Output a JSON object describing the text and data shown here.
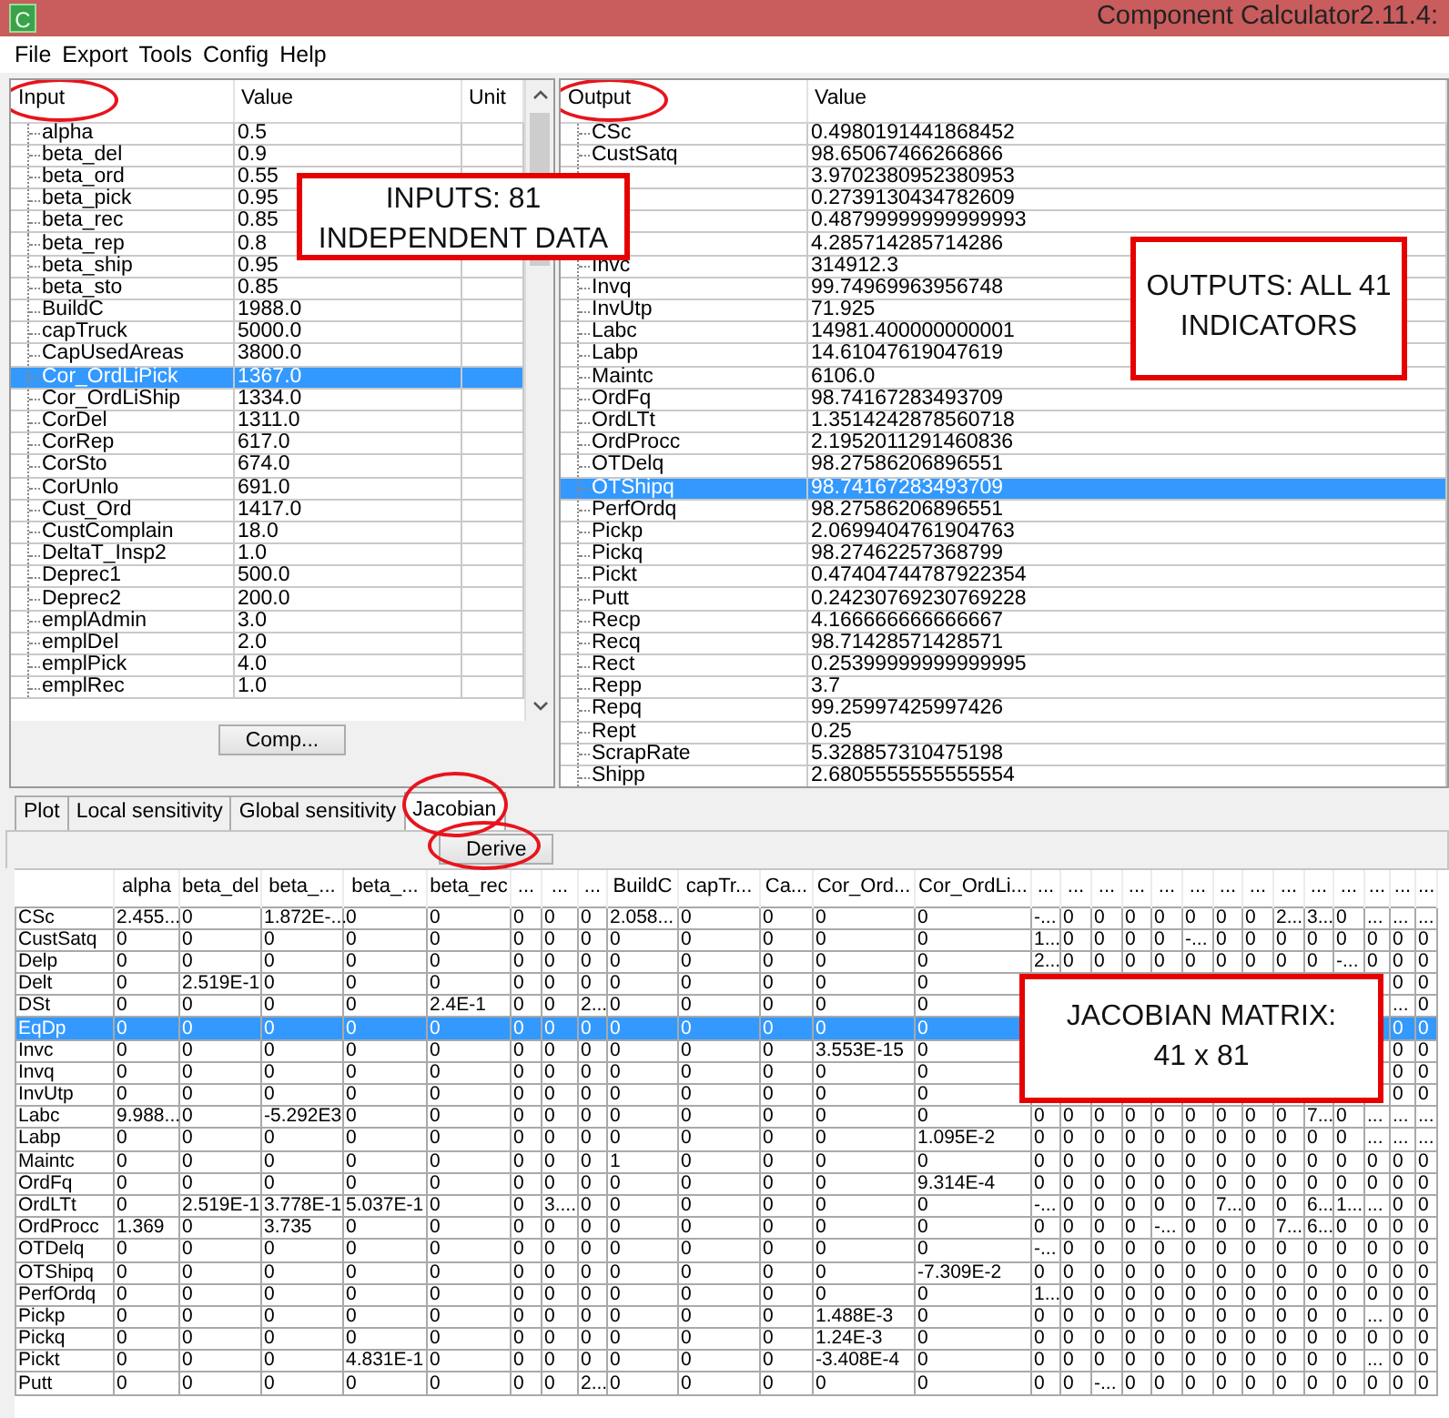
{
  "window": {
    "icon_letter": "C",
    "title": "Component Calculator2.11.4:"
  },
  "menu": [
    "File",
    "Export",
    "Tools",
    "Config",
    "Help"
  ],
  "inputs_table": {
    "columns": [
      {
        "label": "Input",
        "circled": true
      },
      {
        "label": "Value",
        "circled": false
      },
      {
        "label": "Unit",
        "circled": false
      }
    ],
    "rows": [
      {
        "name": "alpha",
        "value": "0.5",
        "selected": false
      },
      {
        "name": "beta_del",
        "value": "0.9",
        "selected": false
      },
      {
        "name": "beta_ord",
        "value": "0.55",
        "selected": false
      },
      {
        "name": "beta_pick",
        "value": "0.95",
        "selected": false
      },
      {
        "name": "beta_rec",
        "value": "0.85",
        "selected": false
      },
      {
        "name": "beta_rep",
        "value": "0.8",
        "selected": false
      },
      {
        "name": "beta_ship",
        "value": "0.95",
        "selected": false
      },
      {
        "name": "beta_sto",
        "value": "0.85",
        "selected": false
      },
      {
        "name": "BuildC",
        "value": "1988.0",
        "selected": false
      },
      {
        "name": "capTruck",
        "value": "5000.0",
        "selected": false
      },
      {
        "name": "CapUsedAreas",
        "value": "3800.0",
        "selected": false
      },
      {
        "name": "Cor_OrdLiPick",
        "value": "1367.0",
        "selected": true
      },
      {
        "name": "Cor_OrdLiShip",
        "value": "1334.0",
        "selected": false
      },
      {
        "name": "CorDel",
        "value": "1311.0",
        "selected": false
      },
      {
        "name": "CorRep",
        "value": "617.0",
        "selected": false
      },
      {
        "name": "CorSto",
        "value": "674.0",
        "selected": false
      },
      {
        "name": "CorUnlo",
        "value": "691.0",
        "selected": false
      },
      {
        "name": "Cust_Ord",
        "value": "1417.0",
        "selected": false
      },
      {
        "name": "CustComplain",
        "value": "18.0",
        "selected": false
      },
      {
        "name": "DeltaT_Insp2",
        "value": "1.0",
        "selected": false
      },
      {
        "name": "Deprec1",
        "value": "500.0",
        "selected": false
      },
      {
        "name": "Deprec2",
        "value": "200.0",
        "selected": false
      },
      {
        "name": "emplAdmin",
        "value": "3.0",
        "selected": false
      },
      {
        "name": "emplDel",
        "value": "2.0",
        "selected": false
      },
      {
        "name": "emplPick",
        "value": "4.0",
        "selected": false
      },
      {
        "name": "emplRec",
        "value": "1.0",
        "selected": false
      }
    ]
  },
  "comp_button": "Comp...",
  "outputs_table": {
    "columns": [
      {
        "label": "Output",
        "circled": true
      },
      {
        "label": "Value",
        "circled": false
      }
    ],
    "rows": [
      {
        "name": "CSc",
        "value": "0.4980191441868452",
        "selected": false
      },
      {
        "name": "CustSatq",
        "value": "98.65067466266866",
        "selected": false
      },
      {
        "name": null,
        "value": "3.9702380952380953",
        "selected": false
      },
      {
        "name": null,
        "value": "0.2739130434782609",
        "selected": false
      },
      {
        "name": null,
        "value": "0.48799999999999993",
        "selected": false
      },
      {
        "name": null,
        "value": "4.285714285714286",
        "selected": false
      },
      {
        "name": "Invc",
        "value": "314912.3",
        "selected": false
      },
      {
        "name": "Invq",
        "value": "99.74969963956748",
        "selected": false
      },
      {
        "name": "InvUtp",
        "value": "71.925",
        "selected": false
      },
      {
        "name": "Labc",
        "value": "14981.400000000001",
        "selected": false
      },
      {
        "name": "Labp",
        "value": "14.61047619047619",
        "selected": false
      },
      {
        "name": "Maintc",
        "value": "6106.0",
        "selected": false
      },
      {
        "name": "OrdFq",
        "value": "98.74167283493709",
        "selected": false
      },
      {
        "name": "OrdLTt",
        "value": "1.3514242878560718",
        "selected": false
      },
      {
        "name": "OrdProcc",
        "value": "2.1952011291460836",
        "selected": false
      },
      {
        "name": "OTDelq",
        "value": "98.27586206896551",
        "selected": false
      },
      {
        "name": "OTShipq",
        "value": "98.74167283493709",
        "selected": true
      },
      {
        "name": "PerfOrdq",
        "value": "98.27586206896551",
        "selected": false
      },
      {
        "name": "Pickp",
        "value": "2.0699404761904763",
        "selected": false
      },
      {
        "name": "Pickq",
        "value": "98.27462257368799",
        "selected": false
      },
      {
        "name": "Pickt",
        "value": "0.47404744787922354",
        "selected": false
      },
      {
        "name": "Putt",
        "value": "0.24230769230769228",
        "selected": false
      },
      {
        "name": "Recp",
        "value": "4.166666666666667",
        "selected": false
      },
      {
        "name": "Recq",
        "value": "98.71428571428571",
        "selected": false
      },
      {
        "name": "Rect",
        "value": "0.25399999999999995",
        "selected": false
      },
      {
        "name": "Repp",
        "value": "3.7",
        "selected": false
      },
      {
        "name": "Repq",
        "value": "99.25997425997426",
        "selected": false
      },
      {
        "name": "Rept",
        "value": "0.25",
        "selected": false
      },
      {
        "name": "ScrapRate",
        "value": "5.328857310475198",
        "selected": false
      },
      {
        "name": "Shipp",
        "value": "2.6805555555555554",
        "selected": false
      }
    ]
  },
  "tabs": [
    {
      "label": "Plot",
      "selected": false,
      "circled": false
    },
    {
      "label": "Local sensitivity",
      "selected": false,
      "circled": false
    },
    {
      "label": "Global sensitivity",
      "selected": false,
      "circled": false
    },
    {
      "label": "Jacobian",
      "selected": true,
      "circled": true
    }
  ],
  "derive_button": {
    "label": "Derive",
    "circled": true
  },
  "jacobian": {
    "columns": [
      "alpha",
      "beta_del",
      "beta_...",
      "beta_...",
      "beta_rec",
      "...",
      "...",
      "...",
      "BuildC",
      "capTr...",
      "Ca...",
      "Cor_Ord...",
      "Cor_OrdLi...",
      "...",
      "...",
      "...",
      "...",
      "...",
      "...",
      "...",
      "...",
      "...",
      "...",
      "...",
      "...",
      "...",
      "..."
    ],
    "rows": [
      {
        "name": "CSc",
        "selected": false,
        "cells": [
          "2.455...",
          "0",
          "1.872E-...",
          "0",
          "0",
          "0",
          "0",
          "0",
          "2.058...",
          "0",
          "0",
          "0",
          "0",
          "-...",
          "0",
          "0",
          "0",
          "0",
          "0",
          "0",
          "0",
          "2...",
          "3...",
          "0",
          "...",
          "...",
          "..."
        ]
      },
      {
        "name": "CustSatq",
        "selected": false,
        "cells": [
          "0",
          "0",
          "0",
          "0",
          "0",
          "0",
          "0",
          "0",
          "0",
          "0",
          "0",
          "0",
          "0",
          "1...",
          "0",
          "0",
          "0",
          "0",
          "-...",
          "0",
          "0",
          "0",
          "0",
          "0",
          "0",
          "0",
          "0"
        ]
      },
      {
        "name": "Delp",
        "selected": false,
        "cells": [
          "0",
          "0",
          "0",
          "0",
          "0",
          "0",
          "0",
          "0",
          "0",
          "0",
          "0",
          "0",
          "0",
          "2...",
          "0",
          "0",
          "0",
          "0",
          "0",
          "0",
          "0",
          "0",
          "0",
          "-...",
          "0",
          "0",
          "0"
        ]
      },
      {
        "name": "Delt",
        "selected": false,
        "cells": [
          "0",
          "2.519E-1",
          "0",
          "0",
          "0",
          "0",
          "0",
          "0",
          "0",
          "0",
          "0",
          "0",
          "0",
          null,
          null,
          null,
          null,
          null,
          null,
          null,
          null,
          null,
          null,
          null,
          null,
          "0",
          "0"
        ]
      },
      {
        "name": "DSt",
        "selected": false,
        "cells": [
          "0",
          "0",
          "0",
          "0",
          "2.4E-1",
          "0",
          "0",
          "2...",
          "0",
          "0",
          "0",
          "0",
          "0",
          null,
          null,
          null,
          null,
          null,
          null,
          null,
          null,
          null,
          null,
          null,
          null,
          "...",
          "0"
        ]
      },
      {
        "name": "EqDp",
        "selected": true,
        "cells": [
          "0",
          "0",
          "0",
          "0",
          "0",
          "0",
          "0",
          "0",
          "0",
          "0",
          "0",
          "0",
          "0",
          null,
          null,
          null,
          null,
          null,
          null,
          null,
          null,
          null,
          null,
          null,
          null,
          "0",
          "0"
        ]
      },
      {
        "name": "Invc",
        "selected": false,
        "cells": [
          "0",
          "0",
          "0",
          "0",
          "0",
          "0",
          "0",
          "0",
          "0",
          "0",
          "0",
          "3.553E-15",
          "0",
          null,
          null,
          null,
          null,
          null,
          null,
          null,
          null,
          null,
          null,
          null,
          null,
          "0",
          "0"
        ]
      },
      {
        "name": "Invq",
        "selected": false,
        "cells": [
          "0",
          "0",
          "0",
          "0",
          "0",
          "0",
          "0",
          "0",
          "0",
          "0",
          "0",
          "0",
          "0",
          null,
          null,
          null,
          null,
          null,
          null,
          null,
          null,
          null,
          null,
          null,
          null,
          "0",
          "0"
        ]
      },
      {
        "name": "InvUtp",
        "selected": false,
        "cells": [
          "0",
          "0",
          "0",
          "0",
          "0",
          "0",
          "0",
          "0",
          "0",
          "0",
          "0",
          "0",
          "0",
          null,
          null,
          null,
          null,
          null,
          null,
          null,
          null,
          null,
          null,
          null,
          null,
          "0",
          "0"
        ]
      },
      {
        "name": "Labc",
        "selected": false,
        "cells": [
          "9.988...",
          "0",
          "-5.292E3",
          "0",
          "0",
          "0",
          "0",
          "0",
          "0",
          "0",
          "0",
          "0",
          "0",
          "0",
          "0",
          "0",
          "0",
          "0",
          "0",
          "0",
          "0",
          "0",
          "7...",
          "0",
          "...",
          "...",
          "..."
        ]
      },
      {
        "name": "Labp",
        "selected": false,
        "cells": [
          "0",
          "0",
          "0",
          "0",
          "0",
          "0",
          "0",
          "0",
          "0",
          "0",
          "0",
          "0",
          "1.095E-2",
          "0",
          "0",
          "0",
          "0",
          "0",
          "0",
          "0",
          "0",
          "0",
          "0",
          "0",
          "...",
          "...",
          "..."
        ]
      },
      {
        "name": "Maintc",
        "selected": false,
        "cells": [
          "0",
          "0",
          "0",
          "0",
          "0",
          "0",
          "0",
          "0",
          "1",
          "0",
          "0",
          "0",
          "0",
          "0",
          "0",
          "0",
          "0",
          "0",
          "0",
          "0",
          "0",
          "0",
          "0",
          "0",
          "0",
          "0",
          "0"
        ]
      },
      {
        "name": "OrdFq",
        "selected": false,
        "cells": [
          "0",
          "0",
          "0",
          "0",
          "0",
          "0",
          "0",
          "0",
          "0",
          "0",
          "0",
          "0",
          "9.314E-4",
          "0",
          "0",
          "0",
          "0",
          "0",
          "0",
          "0",
          "0",
          "0",
          "0",
          "0",
          "0",
          "0",
          "0"
        ]
      },
      {
        "name": "OrdLTt",
        "selected": false,
        "cells": [
          "0",
          "2.519E-1",
          "3.778E-1",
          "5.037E-1",
          "0",
          "0",
          "3....",
          "0",
          "0",
          "0",
          "0",
          "0",
          "0",
          "-...",
          "0",
          "0",
          "0",
          "0",
          "0",
          "7...",
          "0",
          "0",
          "6...",
          "1...",
          "...",
          "0",
          "0"
        ]
      },
      {
        "name": "OrdProcc",
        "selected": false,
        "cells": [
          "1.369",
          "0",
          "3.735",
          "0",
          "0",
          "0",
          "0",
          "0",
          "0",
          "0",
          "0",
          "0",
          "0",
          "0",
          "0",
          "0",
          "0",
          "-...",
          "0",
          "0",
          "0",
          "7...",
          "6...",
          "0",
          "0",
          "0",
          "0"
        ]
      },
      {
        "name": "OTDelq",
        "selected": false,
        "cells": [
          "0",
          "0",
          "0",
          "0",
          "0",
          "0",
          "0",
          "0",
          "0",
          "0",
          "0",
          "0",
          "0",
          "-...",
          "0",
          "0",
          "0",
          "0",
          "0",
          "0",
          "0",
          "0",
          "0",
          "0",
          "0",
          "0",
          "0"
        ]
      },
      {
        "name": "OTShipq",
        "selected": false,
        "cells": [
          "0",
          "0",
          "0",
          "0",
          "0",
          "0",
          "0",
          "0",
          "0",
          "0",
          "0",
          "0",
          "-7.309E-2",
          "0",
          "0",
          "0",
          "0",
          "0",
          "0",
          "0",
          "0",
          "0",
          "0",
          "0",
          "0",
          "0",
          "0"
        ]
      },
      {
        "name": "PerfOrdq",
        "selected": false,
        "cells": [
          "0",
          "0",
          "0",
          "0",
          "0",
          "0",
          "0",
          "0",
          "0",
          "0",
          "0",
          "0",
          "0",
          "1...",
          "0",
          "0",
          "0",
          "0",
          "0",
          "0",
          "0",
          "0",
          "0",
          "0",
          "0",
          "0",
          "0"
        ]
      },
      {
        "name": "Pickp",
        "selected": false,
        "cells": [
          "0",
          "0",
          "0",
          "0",
          "0",
          "0",
          "0",
          "0",
          "0",
          "0",
          "0",
          "1.488E-3",
          "0",
          "0",
          "0",
          "0",
          "0",
          "0",
          "0",
          "0",
          "0",
          "0",
          "0",
          "0",
          "...",
          "0",
          "0"
        ]
      },
      {
        "name": "Pickq",
        "selected": false,
        "cells": [
          "0",
          "0",
          "0",
          "0",
          "0",
          "0",
          "0",
          "0",
          "0",
          "0",
          "0",
          "1.24E-3",
          "0",
          "0",
          "0",
          "0",
          "0",
          "0",
          "0",
          "0",
          "0",
          "0",
          "0",
          "0",
          "0",
          "0",
          "0"
        ]
      },
      {
        "name": "Pickt",
        "selected": false,
        "cells": [
          "0",
          "0",
          "0",
          "4.831E-1",
          "0",
          "0",
          "0",
          "0",
          "0",
          "0",
          "0",
          "-3.408E-4",
          "0",
          "0",
          "0",
          "0",
          "0",
          "0",
          "0",
          "0",
          "0",
          "0",
          "0",
          "0",
          "...",
          "0",
          "0"
        ]
      },
      {
        "name": "Putt",
        "selected": false,
        "cells": [
          "0",
          "0",
          "0",
          "0",
          "0",
          "0",
          "0",
          "2...",
          "0",
          "0",
          "0",
          "0",
          "0",
          "0",
          "0",
          "-...",
          "0",
          "0",
          "0",
          "0",
          "0",
          "0",
          "0",
          "0",
          "0",
          "0",
          "0"
        ]
      }
    ]
  },
  "callouts": [
    {
      "lines": [
        "INPUTS: 81",
        "INDEPENDENT DATA"
      ]
    },
    {
      "lines": [
        "OUTPUTS: ALL 41",
        "INDICATORS"
      ]
    },
    {
      "lines": [
        "JACOBIAN MATRIX:",
        "41 x 81"
      ]
    }
  ]
}
